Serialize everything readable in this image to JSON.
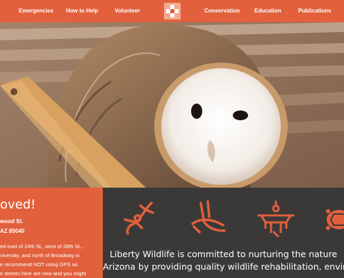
{
  "nav": {
    "items": [
      "Emergencies",
      "How to Help",
      "Volunteer",
      "Conservation",
      "Education",
      "Publications"
    ]
  },
  "hero": {
    "subject": "Barn owl photo"
  },
  "notice": {
    "title": "oved!",
    "address_line1": "wood St.",
    "address_line2": "AZ 85040",
    "directions": [
      "ed east of 24th St., west of 28th St.,",
      "niversity, and north of Broadway in",
      "e recommend NOT using GPS as",
      "e streets here are new and you might"
    ]
  },
  "mission": {
    "lines": [
      "Liberty Wildlife is committed to nurturing the nature",
      "Arizona by providing quality wildlife rehabilitation, environ"
    ]
  },
  "icons": [
    "lizard-petroglyph-icon",
    "rabbit-petroglyph-icon",
    "eagle-petroglyph-icon",
    "turtle-petroglyph-icon"
  ],
  "colors": {
    "accent": "#e2603c",
    "dark_panel": "#3b3938",
    "logo_background": "#f4a98f"
  }
}
